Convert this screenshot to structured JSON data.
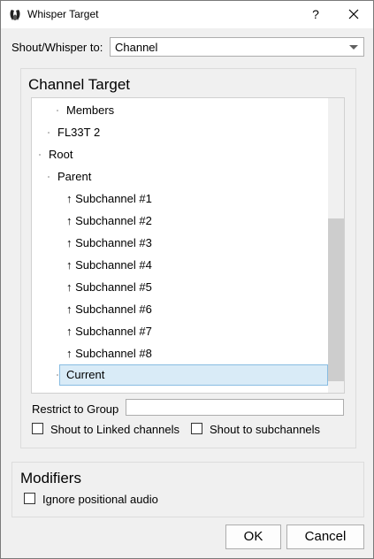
{
  "window": {
    "title": "Whisper Target",
    "help": "?"
  },
  "shout_whisper": {
    "label": "Shout/Whisper to:",
    "value": "Channel"
  },
  "channel_target": {
    "title": "Channel Target",
    "tree": [
      {
        "label": "Members"
      },
      {
        "label": "FL33T 2"
      },
      {
        "label": "Root"
      },
      {
        "label": "Parent"
      },
      {
        "label": "↑ Subchannel #1"
      },
      {
        "label": "↑ Subchannel #2"
      },
      {
        "label": "↑ Subchannel #3"
      },
      {
        "label": "↑ Subchannel #4"
      },
      {
        "label": "↑ Subchannel #5"
      },
      {
        "label": "↑ Subchannel #6"
      },
      {
        "label": "↑ Subchannel #7"
      },
      {
        "label": "↑ Subchannel #8"
      },
      {
        "label": "Current"
      }
    ],
    "restrict_label": "Restrict to Group",
    "restrict_value": "",
    "shout_linked_label": "Shout to Linked channels",
    "shout_sub_label": "Shout to subchannels"
  },
  "modifiers": {
    "title": "Modifiers",
    "ignore_positional_label": "Ignore positional audio"
  },
  "buttons": {
    "ok": "OK",
    "cancel": "Cancel"
  }
}
